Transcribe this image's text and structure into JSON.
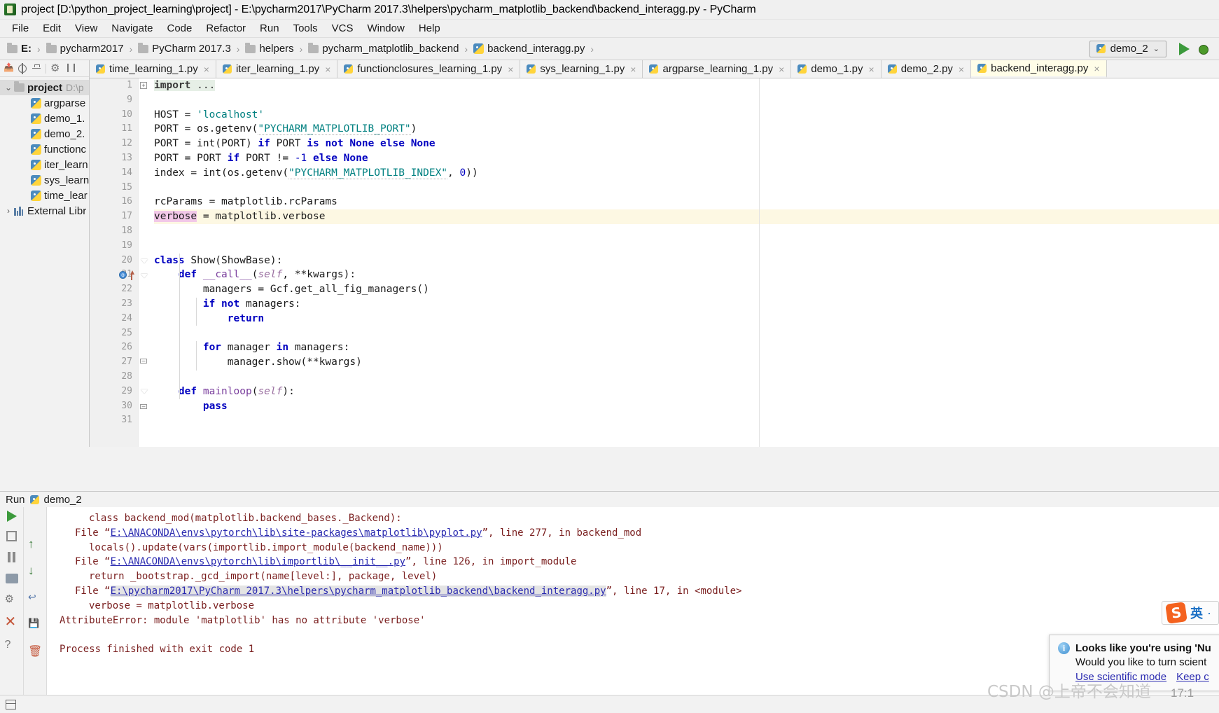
{
  "window": {
    "title": "project [D:\\python_project_learning\\project] - E:\\pycharm2017\\PyCharm 2017.3\\helpers\\pycharm_matplotlib_backend\\backend_interagg.py - PyCharm",
    "app_icon": "pycharm-icon"
  },
  "menu": {
    "items": [
      "File",
      "Edit",
      "View",
      "Navigate",
      "Code",
      "Refactor",
      "Run",
      "Tools",
      "VCS",
      "Window",
      "Help"
    ]
  },
  "breadcrumb": {
    "items": [
      {
        "label": "E:",
        "icon": "folder-icon",
        "bold": true
      },
      {
        "label": "pycharm2017",
        "icon": "folder-icon"
      },
      {
        "label": "PyCharm 2017.3",
        "icon": "folder-icon"
      },
      {
        "label": "helpers",
        "icon": "folder-icon"
      },
      {
        "label": "pycharm_matplotlib_backend",
        "icon": "folder-icon"
      },
      {
        "label": "backend_interagg.py",
        "icon": "python-file-icon"
      }
    ],
    "separator": "›"
  },
  "toolbar": {
    "run_config": "demo_2",
    "run_config_icon": "python-icon",
    "dropdown_chevron": "⌄",
    "run_button": "run-icon",
    "debug_button": "debug-icon"
  },
  "sidebar": {
    "toolbar_icons": [
      "select-opened-file-icon",
      "target-icon",
      "collapse-all-icon",
      "gear-icon",
      "hide-icon"
    ],
    "tree": [
      {
        "label": "project",
        "path": "D:\\p",
        "expander": "⌄",
        "icon": "folder-icon",
        "level": 0,
        "selected": true
      },
      {
        "label": "argparse",
        "icon": "python-file-icon",
        "level": 1
      },
      {
        "label": "demo_1.",
        "icon": "python-file-icon",
        "level": 1
      },
      {
        "label": "demo_2.",
        "icon": "python-file-icon",
        "level": 1
      },
      {
        "label": "functionc",
        "icon": "python-file-icon",
        "level": 1
      },
      {
        "label": "iter_learn",
        "icon": "python-file-icon",
        "level": 1
      },
      {
        "label": "sys_learn",
        "icon": "python-file-icon",
        "level": 1
      },
      {
        "label": "time_lear",
        "icon": "python-file-icon",
        "level": 1
      },
      {
        "label": "External Libr",
        "expander": "›",
        "icon": "library-icon",
        "level": 0
      }
    ]
  },
  "editor": {
    "tabs": [
      {
        "label": "time_learning_1.py",
        "active": false
      },
      {
        "label": "iter_learning_1.py",
        "active": false
      },
      {
        "label": "functionclosures_learning_1.py",
        "active": false
      },
      {
        "label": "sys_learning_1.py",
        "active": false
      },
      {
        "label": "argparse_learning_1.py",
        "active": false
      },
      {
        "label": "demo_1.py",
        "active": false
      },
      {
        "label": "demo_2.py",
        "active": false
      },
      {
        "label": "backend_interagg.py",
        "active": true
      }
    ],
    "close_glyph": "×",
    "line_numbers": [
      1,
      9,
      10,
      11,
      12,
      13,
      14,
      15,
      16,
      17,
      18,
      19,
      20,
      21,
      22,
      23,
      24,
      25,
      26,
      27,
      28,
      29,
      30,
      31
    ],
    "highlighted_line": 17,
    "breakpoint_line": 21,
    "code_lines": [
      "import ...",
      "",
      "HOST = 'localhost'",
      "PORT = os.getenv(\"PYCHARM_MATPLOTLIB_PORT\")",
      "PORT = int(PORT) if PORT is not None else None",
      "PORT = PORT if PORT != -1 else None",
      "index = int(os.getenv(\"PYCHARM_MATPLOTLIB_INDEX\", 0))",
      "",
      "rcParams = matplotlib.rcParams",
      "verbose = matplotlib.verbose",
      "",
      "",
      "class Show(ShowBase):",
      "    def __call__(self, **kwargs):",
      "        managers = Gcf.get_all_fig_managers()",
      "        if not managers:",
      "            return",
      "",
      "        for manager in managers:",
      "            manager.show(**kwargs)",
      "",
      "    def mainloop(self):",
      "        pass",
      ""
    ]
  },
  "run_panel": {
    "header_label": "Run",
    "header_config": "demo_2",
    "header_icon": "python-icon",
    "side_icons": [
      "rerun-icon",
      "scroll-up-icon",
      "stop-icon",
      "scroll-down-icon",
      "pause-icon",
      "soft-wrap-icon",
      "print-icon",
      "export-icon",
      "settings-icon",
      "trash-icon",
      "close-icon",
      "help-icon"
    ],
    "console": [
      {
        "indent": 4,
        "text": "class backend_mod(matplotlib.backend_bases._Backend):"
      },
      {
        "indent": 2,
        "prefix": "File “",
        "link": "E:\\ANACONDA\\envs\\pytorch\\lib\\site-packages\\matplotlib\\pyplot.py",
        "suffix": "”, line 277, in backend_mod"
      },
      {
        "indent": 4,
        "text": "locals().update(vars(importlib.import_module(backend_name)))"
      },
      {
        "indent": 2,
        "prefix": "File “",
        "link": "E:\\ANACONDA\\envs\\pytorch\\lib\\importlib\\__init__.py",
        "suffix": "”, line 126, in import_module"
      },
      {
        "indent": 4,
        "text": "return _bootstrap._gcd_import(name[level:], package, level)"
      },
      {
        "indent": 2,
        "prefix": "File “",
        "link": "E:\\pycharm2017\\PyCharm 2017.3\\helpers\\pycharm_matplotlib_backend\\backend_interagg.py",
        "suffix": "”, line 17, in <module>",
        "highlighted": true
      },
      {
        "indent": 4,
        "text": "verbose = matplotlib.verbose"
      },
      {
        "indent": 0,
        "text": "AttributeError: module 'matplotlib' has no attribute 'verbose'"
      },
      {
        "indent": 0,
        "text": ""
      },
      {
        "indent": 0,
        "text": "Process finished with exit code 1"
      }
    ]
  },
  "notification": {
    "icon": "info-icon",
    "title": "Looks like you're using 'Nu",
    "subtitle": "Would you like to turn scient",
    "actions": [
      "Use scientific mode",
      "Keep c"
    ]
  },
  "ime": {
    "logo": "sogou-icon",
    "mode": "英",
    "dot": "·"
  },
  "statusbar": {
    "layout_icon": "toggle-toolwindow-icon"
  },
  "watermark": {
    "text": "CSDN @上帝不会知道"
  },
  "clock": {
    "time": "17:1"
  },
  "colors": {
    "accent_green": "#3c9a3c",
    "link_blue": "#2a2ab0",
    "keyword_blue": "#0000c0",
    "string_teal": "#008080",
    "error_red": "#7a1f1f",
    "highlight_line": "#fdf8e3",
    "highlight_ident": "#f2c8e8",
    "sogou_orange": "#f4621f"
  }
}
